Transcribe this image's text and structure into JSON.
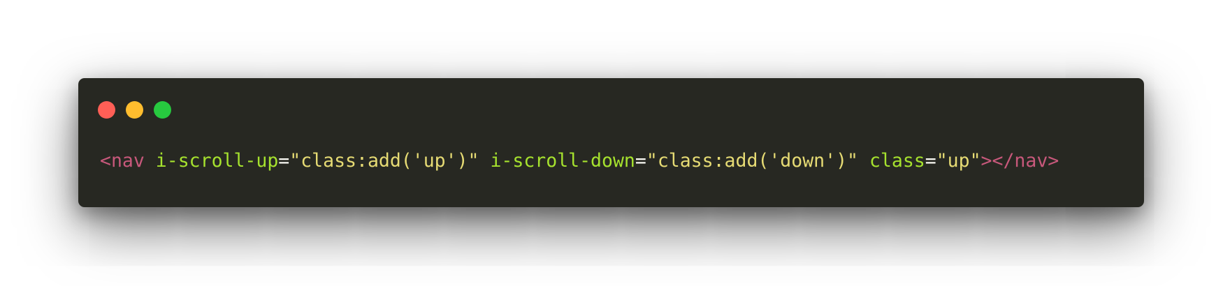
{
  "window": {
    "controls": {
      "close_color": "#ff5f56",
      "minimize_color": "#ffbd2e",
      "maximize_color": "#27c93f"
    },
    "background": "#272822"
  },
  "code": {
    "colors": {
      "tag": "#c7587b",
      "attribute": "#a6e22e",
      "string": "#e6db74",
      "punctuation": "#f8f8f2"
    },
    "tokens": {
      "open_tag": "<nav",
      "attr1": "i-scroll-up",
      "eq1": "=",
      "val1": "\"class:add('up')\"",
      "attr2": "i-scroll-down",
      "eq2": "=",
      "val2": "\"class:add('down')\"",
      "attr3": "class",
      "eq3": "=",
      "val3": "\"up\"",
      "close_tag": "></nav>"
    }
  }
}
